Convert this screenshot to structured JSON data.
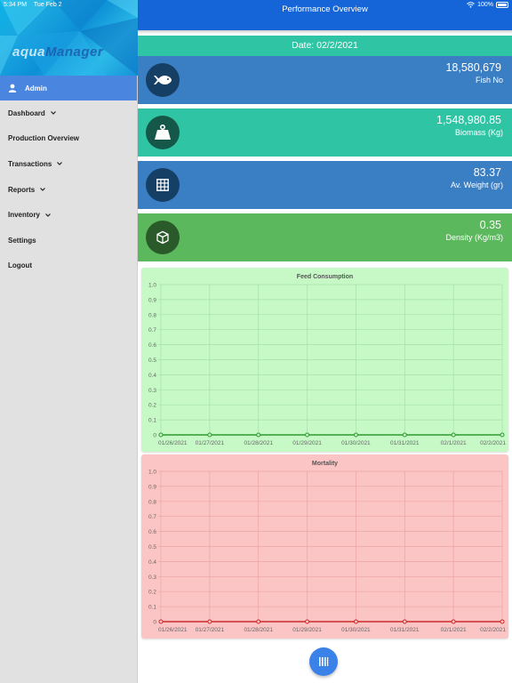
{
  "status_bar": {
    "time": "5:34 PM",
    "date": "Tue Feb 2",
    "battery": "100%",
    "battery_level": 1.0
  },
  "sidebar": {
    "logo_part1": "aqua",
    "logo_part2": "Manager",
    "user": "Admin",
    "items": [
      {
        "label": "Dashboard",
        "has_chevron": true
      },
      {
        "label": "Production Overview",
        "has_chevron": false
      },
      {
        "label": "Transactions",
        "has_chevron": true
      },
      {
        "label": "Reports",
        "has_chevron": true
      },
      {
        "label": "Inventory",
        "has_chevron": true
      },
      {
        "label": "Settings",
        "has_chevron": false
      },
      {
        "label": "Logout",
        "has_chevron": false
      }
    ]
  },
  "header": {
    "title": "Performance Overview"
  },
  "date_label": "Date: 02/2/2021",
  "stats": [
    {
      "value": "18,580,679",
      "label": "Fish No",
      "icon": "fish-icon",
      "bg": "#3a7ec4",
      "icon_bg": "#163f66"
    },
    {
      "value": "1,548,980.85",
      "label": "Biomass (Kg)",
      "icon": "weight-icon",
      "bg": "#2ec4a4",
      "icon_bg": "#15584a"
    },
    {
      "value": "83.37",
      "label": "Av. Weight (gr)",
      "icon": "grid-icon",
      "bg": "#3a7ec4",
      "icon_bg": "#163f66"
    },
    {
      "value": "0.35",
      "label": "Density (Kg/m3)",
      "icon": "cube-icon",
      "bg": "#5cb85c",
      "icon_bg": "#2a5a2a"
    }
  ],
  "chart_data": [
    {
      "type": "line",
      "title": "Feed Consumption",
      "categories": [
        "01/26/2021",
        "01/27/2021",
        "01/28/2021",
        "01/29/2021",
        "01/30/2021",
        "01/31/2021",
        "02/1/2021",
        "02/2/2021"
      ],
      "series": [
        {
          "values": [
            0,
            0,
            0,
            0,
            0,
            0,
            0,
            0
          ]
        }
      ],
      "ylim": [
        0,
        1.0
      ],
      "yticks": [
        "1.0",
        "0.9",
        "0.8",
        "0.7",
        "0.6",
        "0.5",
        "0.4",
        "0.3",
        "0.2",
        "0.1",
        "0"
      ],
      "grid": true,
      "bg": "#c6f9c6",
      "line_color": "#2e9a2e",
      "grid_color": "#a6e0a6"
    },
    {
      "type": "line",
      "title": "Mortality",
      "categories": [
        "01/26/2021",
        "01/27/2021",
        "01/28/2021",
        "01/29/2021",
        "01/30/2021",
        "01/31/2021",
        "02/1/2021",
        "02/2/2021"
      ],
      "series": [
        {
          "values": [
            0,
            0,
            0,
            0,
            0,
            0,
            0,
            0
          ]
        }
      ],
      "ylim": [
        0,
        1.0
      ],
      "yticks": [
        "1.0",
        "0.9",
        "0.8",
        "0.7",
        "0.6",
        "0.5",
        "0.4",
        "0.3",
        "0.2",
        "0.1",
        "0"
      ],
      "grid": true,
      "bg": "#fcc5c5",
      "line_color": "#cc2a2a",
      "grid_color": "#eaa5a5"
    }
  ],
  "fab": {
    "icon": "bars-icon"
  }
}
